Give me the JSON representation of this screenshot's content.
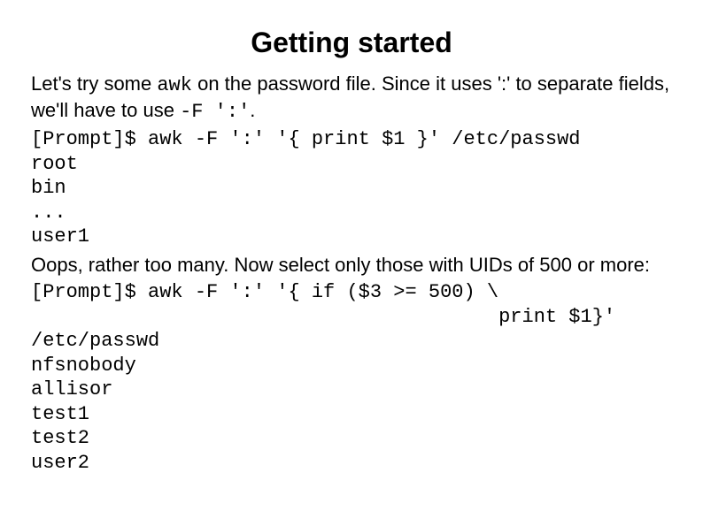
{
  "title": "Getting started",
  "p1_a": "Let's try some ",
  "p1_code1": "awk",
  "p1_b": " on the password file. Since it uses ':' to separate fields, we'll have to use ",
  "p1_code2": " -F ':'",
  "p1_c": ".",
  "block1": "[Prompt]$ awk -F ':' '{ print $1 }' /etc/passwd\nroot\nbin\n...\nuser1",
  "p2": "Oops, rather too many. Now select only those with UIDs of 500 or more:",
  "block2": "[Prompt]$ awk -F ':' '{ if ($3 >= 500) \\\n                                        print $1}'\n/etc/passwd\nnfsnobody\nallisor\ntest1\ntest2\nuser2"
}
